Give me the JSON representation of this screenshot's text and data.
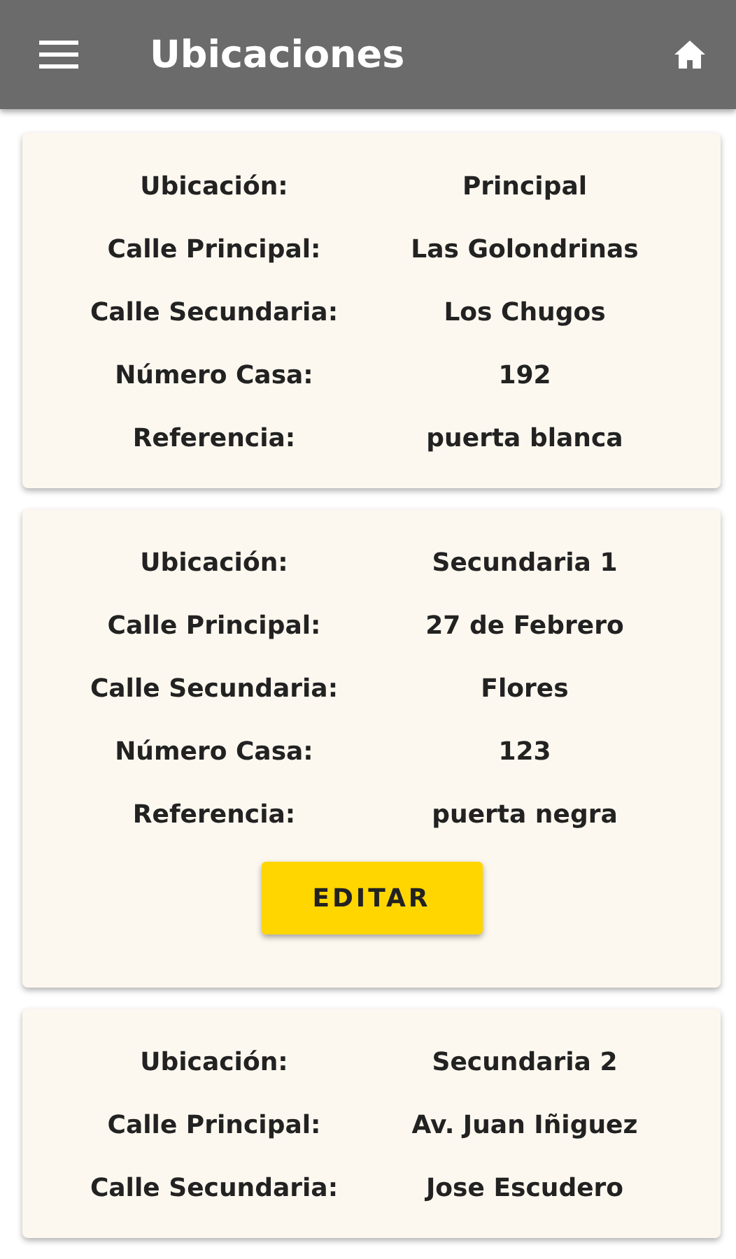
{
  "header": {
    "title": "Ubicaciones"
  },
  "cards": [
    {
      "fields": [
        {
          "label": "Ubicación:",
          "value": "Principal"
        },
        {
          "label": "Calle Principal:",
          "value": "Las Golondrinas"
        },
        {
          "label": "Calle Secundaria:",
          "value": "Los Chugos"
        },
        {
          "label": "Número Casa:",
          "value": "192"
        },
        {
          "label": "Referencia:",
          "value": "puerta blanca"
        }
      ]
    },
    {
      "fields": [
        {
          "label": "Ubicación:",
          "value": "Secundaria 1"
        },
        {
          "label": "Calle Principal:",
          "value": "27 de Febrero"
        },
        {
          "label": "Calle Secundaria:",
          "value": "Flores"
        },
        {
          "label": "Número Casa:",
          "value": "123"
        },
        {
          "label": "Referencia:",
          "value": "puerta negra"
        }
      ],
      "button": "EDITAR"
    },
    {
      "fields": [
        {
          "label": "Ubicación:",
          "value": "Secundaria 2"
        },
        {
          "label": "Calle Principal:",
          "value": "Av. Juan Iñiguez"
        },
        {
          "label": "Calle Secundaria:",
          "value": "Jose Escudero"
        }
      ]
    }
  ]
}
